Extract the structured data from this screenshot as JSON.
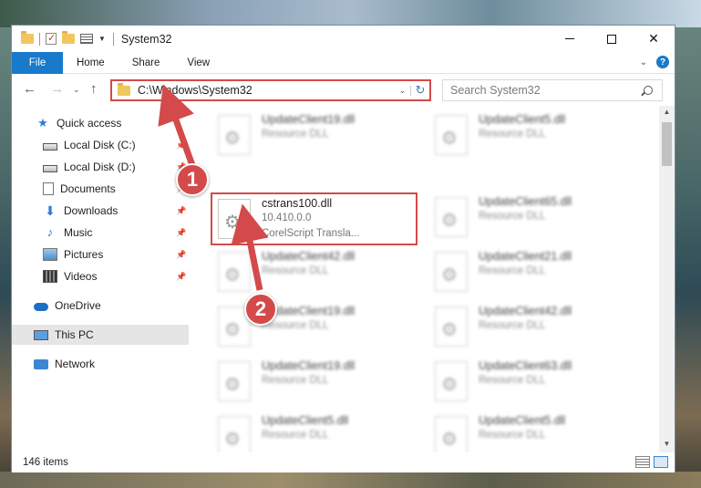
{
  "window": {
    "title": "System32",
    "controls": {
      "minimize": "minimize",
      "maximize": "maximize",
      "close": "✕"
    }
  },
  "ribbon": {
    "tabs": [
      {
        "label": "File"
      },
      {
        "label": "Home"
      },
      {
        "label": "Share"
      },
      {
        "label": "View"
      }
    ]
  },
  "address": {
    "path": "C:\\Windows\\System32",
    "refresh_icon": "refresh-icon"
  },
  "search": {
    "placeholder": "Search System32"
  },
  "sidebar": {
    "items": [
      {
        "label": "Quick access",
        "icon": "star-icon"
      },
      {
        "label": "Local Disk (C:)",
        "icon": "drive-icon",
        "pinned": true
      },
      {
        "label": "Local Disk (D:)",
        "icon": "drive-icon",
        "pinned": true
      },
      {
        "label": "Documents",
        "icon": "documents-icon",
        "pinned": true
      },
      {
        "label": "Downloads",
        "icon": "downloads-icon",
        "pinned": true
      },
      {
        "label": "Music",
        "icon": "music-icon",
        "pinned": true
      },
      {
        "label": "Pictures",
        "icon": "pictures-icon",
        "pinned": true
      },
      {
        "label": "Videos",
        "icon": "videos-icon",
        "pinned": true
      },
      {
        "label": "OneDrive",
        "icon": "cloud-icon"
      },
      {
        "label": "This PC",
        "icon": "pc-icon",
        "selected": true
      },
      {
        "label": "Network",
        "icon": "network-icon"
      }
    ]
  },
  "files": {
    "left": [
      {
        "name": "UpdateClient19.dll",
        "type": "Resource DLL"
      },
      {
        "name": "cstrans100.dll",
        "version": "10.410.0.0",
        "description": "CorelScript Transla..."
      },
      {
        "name": "UpdateClient42.dll",
        "type": "Resource DLL"
      },
      {
        "name": "UpdateClient19.dll",
        "type": "Resource DLL"
      },
      {
        "name": "UpdateClient19.dll",
        "type": "Resource DLL"
      },
      {
        "name": "UpdateClient5.dll",
        "type": "Resource DLL"
      }
    ],
    "right": [
      {
        "name": "UpdateClient5.dll",
        "type": "Resource DLL"
      },
      {
        "name": "UpdateClient65.dll",
        "type": "Resource DLL"
      },
      {
        "name": "UpdateClient21.dll",
        "type": "Resource DLL"
      },
      {
        "name": "UpdateClient42.dll",
        "type": "Resource DLL"
      },
      {
        "name": "UpdateClient63.dll",
        "type": "Resource DLL"
      },
      {
        "name": "UpdateClient5.dll",
        "type": "Resource DLL"
      }
    ]
  },
  "status": {
    "item_count": "146 items"
  },
  "annotations": {
    "step1": "1",
    "step2": "2",
    "color": "#d44a4a"
  }
}
